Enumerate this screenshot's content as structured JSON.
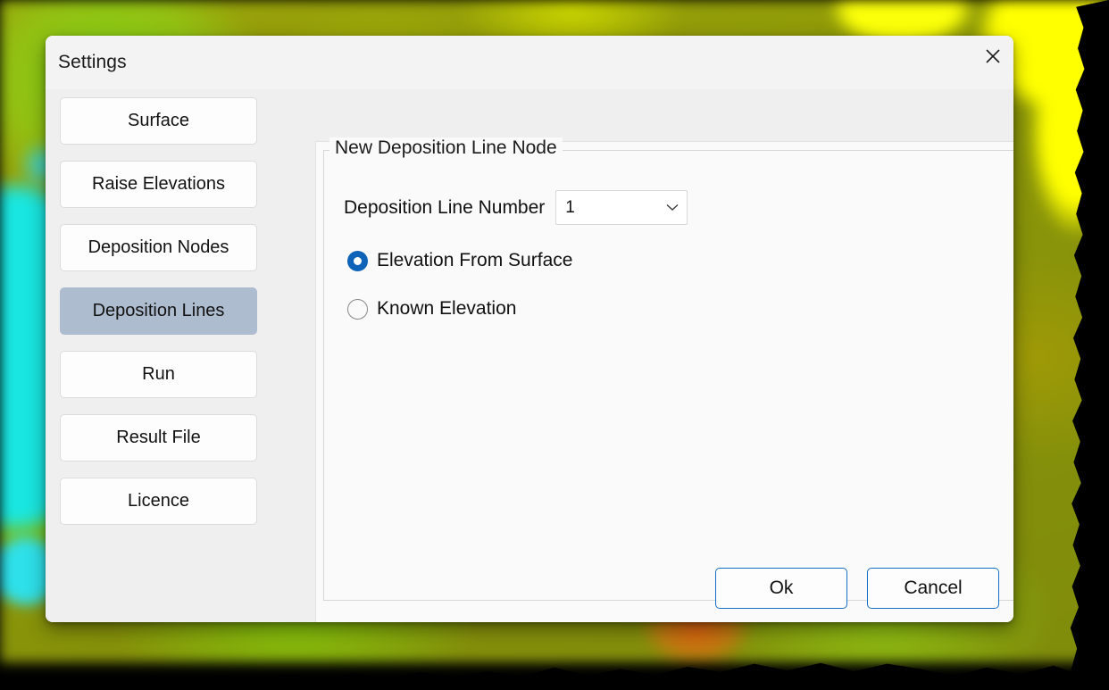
{
  "dialog": {
    "title": "Settings",
    "close_icon": "close-icon"
  },
  "sidebar": {
    "items": [
      {
        "label": "Surface",
        "selected": false
      },
      {
        "label": "Raise Elevations",
        "selected": false
      },
      {
        "label": "Deposition Nodes",
        "selected": false
      },
      {
        "label": "Deposition Lines",
        "selected": true
      },
      {
        "label": "Run",
        "selected": false
      },
      {
        "label": "Result File",
        "selected": false
      },
      {
        "label": "Licence",
        "selected": false
      }
    ]
  },
  "content": {
    "groupbox_title": "New Deposition Line Node",
    "field": {
      "label": "Deposition Line Number",
      "value": "1",
      "chevron_icon": "chevron-down-icon"
    },
    "radios": [
      {
        "label": "Elevation From Surface",
        "checked": true
      },
      {
        "label": "Known Elevation",
        "checked": false
      }
    ]
  },
  "footer": {
    "ok_label": "Ok",
    "cancel_label": "Cancel"
  },
  "colors": {
    "accent_blue": "#0e63b8",
    "button_border_blue": "#1470c4",
    "selected_nav": "#aebccf",
    "dialog_bg": "#f3f3f3",
    "body_bg": "#efefef",
    "panel_bg": "#fafafa"
  }
}
